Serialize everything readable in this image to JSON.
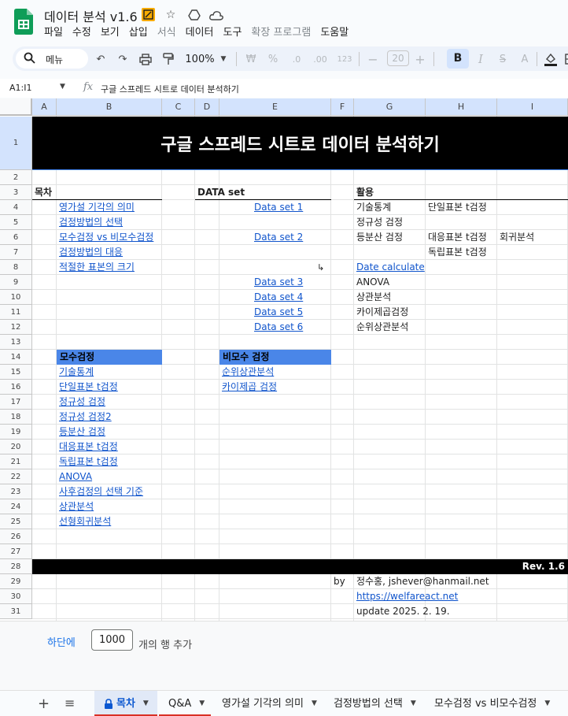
{
  "app": {
    "title": "데이터 분석 v1.6",
    "menu": [
      "파일",
      "수정",
      "보기",
      "삽입",
      "서식",
      "데이터",
      "도구",
      "확장 프로그램",
      "도움말"
    ],
    "menu_dim": [
      false,
      false,
      false,
      false,
      true,
      false,
      false,
      true,
      false
    ]
  },
  "toolbar": {
    "search_label": "메뉴",
    "zoom": "100%",
    "currency": "₩",
    "percent": "%",
    "dec_less": ".0",
    "dec_more": ".00",
    "number_format": "123",
    "font_size": "20",
    "bold": "B",
    "italic": "I",
    "strike": "S",
    "text_color": "A"
  },
  "formula_bar": {
    "cell_ref": "A1:I1",
    "fx": "fx",
    "content": "구글 스프레드 시트로 데이터 분석하기"
  },
  "columns": [
    "A",
    "B",
    "C",
    "D",
    "E",
    "F",
    "G",
    "H",
    "I"
  ],
  "rows": [
    "1",
    "2",
    "3",
    "4",
    "5",
    "6",
    "7",
    "8",
    "9",
    "10",
    "11",
    "12",
    "13",
    "14",
    "15",
    "16",
    "17",
    "18",
    "19",
    "20",
    "21",
    "22",
    "23",
    "24",
    "25",
    "26",
    "27",
    "28",
    "29",
    "30",
    "31"
  ],
  "sheet": {
    "banner": "구글 스프레드 시트로 데이터 분석하기",
    "toc_header": "목차",
    "toc": [
      "영가설 기각의 의미",
      "검정방법의 선택",
      "모수검정 vs 비모수검정",
      "검정방법의 대응",
      "적절한 표본의 크기"
    ],
    "dataset_header": "DATA set",
    "datasets": [
      {
        "row": 4,
        "label": "Data set 1"
      },
      {
        "row": 6,
        "label": "Data set 2"
      },
      {
        "row": 9,
        "label": "Data set 3"
      },
      {
        "row": 10,
        "label": "Data set 4"
      },
      {
        "row": 11,
        "label": "Data set 5"
      },
      {
        "row": 12,
        "label": "Data set 6"
      }
    ],
    "arrow_mark": "↳",
    "use_header": "활용",
    "use_g": [
      {
        "row": 4,
        "label": "기술통계",
        "link": false
      },
      {
        "row": 5,
        "label": "정규성 검정",
        "link": false
      },
      {
        "row": 6,
        "label": "등분산 검정",
        "link": false
      },
      {
        "row": 8,
        "label": "Date calculate",
        "link": true
      },
      {
        "row": 9,
        "label": "ANOVA",
        "link": false
      },
      {
        "row": 10,
        "label": "상관분석",
        "link": false
      },
      {
        "row": 11,
        "label": "카이제곱검정",
        "link": false
      },
      {
        "row": 12,
        "label": "순위상관분석",
        "link": false
      }
    ],
    "use_h": [
      {
        "row": 4,
        "label": "단일표본 t검정"
      },
      {
        "row": 6,
        "label": "대응표본 t검정"
      },
      {
        "row": 7,
        "label": "독립표본 t검정"
      }
    ],
    "use_i": [
      {
        "row": 6,
        "label": "회귀분석"
      }
    ],
    "param_header": "모수검정",
    "param_tests": [
      "기술통계",
      "단일표본 t검정",
      "정규성 검정",
      "정규성 검정2",
      "등분산 검정",
      "대응표본 t검정",
      "독립표본 t검정",
      "ANOVA",
      "사후검정의 선택 기준",
      "상관분석",
      "선형회귀분석"
    ],
    "nonparam_header": "비모수 검정",
    "nonparam_tests": [
      "순위상관분석",
      "카이제곱 검정"
    ],
    "revision": "Rev. 1.6",
    "by_label": "by",
    "author": "정수홍, jshever@hanmail.net",
    "website": "https://welfareact.net",
    "update": "update 2025. 2. 19."
  },
  "add_rows": {
    "link": "하단에",
    "count": "1000",
    "suffix": "개의 행 추가"
  },
  "tabs": [
    {
      "label": "목차",
      "active": true,
      "locked": true
    },
    {
      "label": "Q&A",
      "active": false,
      "locked": false
    },
    {
      "label": "영가설 기각의 의미",
      "active": false,
      "locked": false
    },
    {
      "label": "검정방법의 선택",
      "active": false,
      "locked": false
    },
    {
      "label": "모수검정 vs 비모수검정",
      "active": false,
      "locked": false
    }
  ],
  "colors": {
    "accent_blue": "#4a86e8",
    "link": "#1155cc",
    "tab_underline": "#d93025",
    "sheets_green": "#0f9d58"
  }
}
